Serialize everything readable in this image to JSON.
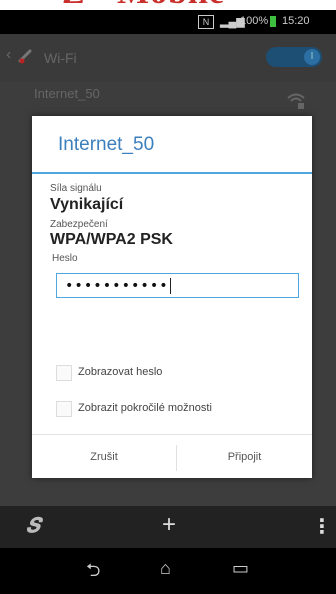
{
  "watermark": {
    "text": "Z · Mobile"
  },
  "statusbar": {
    "nfc": "N",
    "signal": "▂▄▆",
    "battery_pct": "100%",
    "time": "15:20"
  },
  "header": {
    "back": "‹",
    "title": "Wi-Fi",
    "toggle_state": "on",
    "toggle_glyph": "I"
  },
  "network": {
    "name": "Internet_50"
  },
  "dialog": {
    "title": "Internet_50",
    "signal_label": "Síla signálu",
    "signal_value": "Vynikající",
    "security_label": "Zabezpečení",
    "security_value": "WPA/WPA2 PSK",
    "password_label": "Heslo",
    "password_value": "•••••••••••",
    "show_password_label": "Zobrazovat heslo",
    "show_password_checked": false,
    "advanced_label": "Zobrazit pokročilé možnosti",
    "advanced_checked": false,
    "cancel_label": "Zrušit",
    "connect_label": "Připojit"
  },
  "bottombar": {
    "app_icon": "𝑺",
    "add_icon": "+",
    "menu_icon": "⋮"
  },
  "navbar": {
    "back_icon": "⮌",
    "home_icon": "⌂",
    "recent_icon": "▭"
  },
  "colors": {
    "accent": "#3b7fbd",
    "divider": "#4fa7e0",
    "toggle": "#1d4e73"
  }
}
